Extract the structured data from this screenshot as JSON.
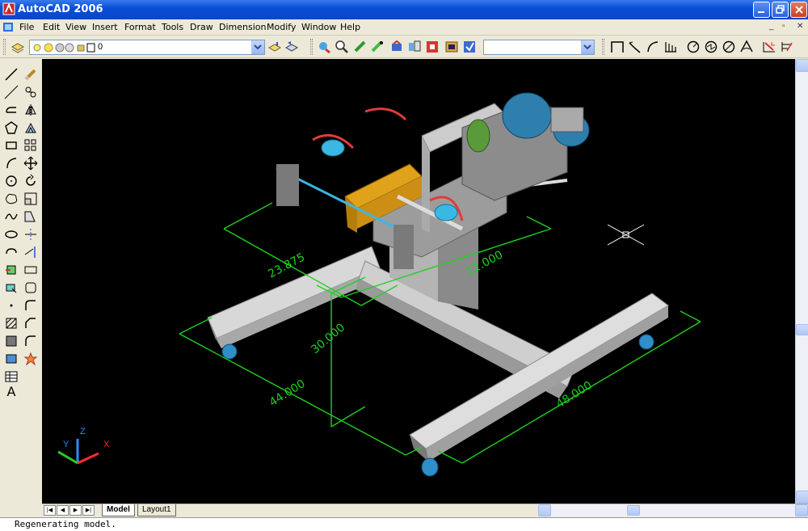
{
  "window": {
    "title": "AutoCAD 2006"
  },
  "menu": [
    "File",
    "Edit",
    "View",
    "Insert",
    "Format",
    "Tools",
    "Draw",
    "Dimension",
    "Modify",
    "Window",
    "Help"
  ],
  "layer": {
    "current": "0"
  },
  "dimensions": {
    "d1": "23.875",
    "d2": "12.000",
    "d3": "30.000",
    "d4": "44.000",
    "d5": "48.000"
  },
  "ucs": {
    "x": "X",
    "y": "Y",
    "z": "Z"
  },
  "tabs": {
    "model": "Model",
    "layout": "Layout1"
  },
  "command": {
    "text": "Regenerating model."
  },
  "colors": {
    "titlebar": "#0a4fd8",
    "canvas": "#000000",
    "dimension": "#1ed11e",
    "frame": "#c8c8c8"
  }
}
